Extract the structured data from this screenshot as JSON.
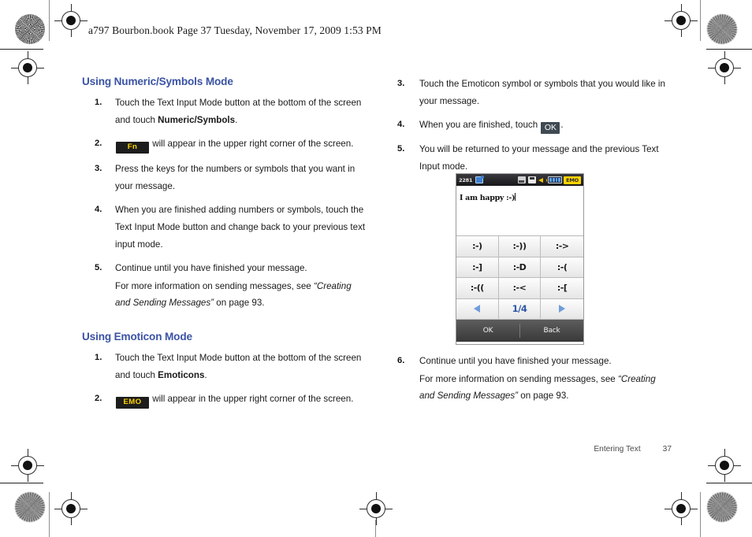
{
  "running_head": "a797 Bourbon.book  Page 37  Tuesday, November 17, 2009  1:53 PM",
  "accent_heading_color": "#3a53a4",
  "left_column": {
    "section1_title": "Using Numeric/Symbols Mode",
    "section1_steps": [
      {
        "num": "1.",
        "pre": "Touch the Text Input Mode button at the bottom of the screen and touch ",
        "bold": "Numeric/Symbols",
        "post": "."
      },
      {
        "num": "2.",
        "badge": "Fn",
        "pre": "",
        "post": " will appear in the upper right corner of the screen."
      },
      {
        "num": "3.",
        "pre": "Press the keys for the numbers or symbols that you want in your message.",
        "post": ""
      },
      {
        "num": "4.",
        "pre": "When you are finished adding numbers or symbols, touch the Text Input Mode button and change back to your previous text input mode.",
        "post": ""
      },
      {
        "num": "5.",
        "pre": "Continue until you have finished your message.",
        "post": ""
      }
    ],
    "section1_note_pre": "For more information on sending messages, see ",
    "section1_note_italic": "“Creating and Sending Messages”",
    "section1_note_post": " on page 93.",
    "section2_title": "Using Emoticon Mode",
    "section2_steps": [
      {
        "num": "1.",
        "pre": "Touch the Text Input Mode button at the bottom of the screen and touch ",
        "bold": "Emoticons",
        "post": "."
      },
      {
        "num": "2.",
        "badge": "EMO",
        "pre": "",
        "post": " will appear in the upper right corner of the screen."
      }
    ]
  },
  "right_column": {
    "steps_top": [
      {
        "num": "3.",
        "pre": "Touch the Emoticon symbol or symbols that you would like in your message.",
        "post": ""
      },
      {
        "num": "4.",
        "pre": "When you are finished, touch ",
        "badge_ok": "OK",
        "post": "."
      },
      {
        "num": "5.",
        "pre": "You will be returned to your message and the previous Text Input mode.",
        "post": ""
      }
    ],
    "step_after": {
      "num": "6.",
      "pre": "Continue until you have finished your message.",
      "post": ""
    },
    "note_pre": "For more information on sending messages, see ",
    "note_italic": "“Creating and Sending Messages”",
    "note_post": " on page 93."
  },
  "phone_screenshot": {
    "status_bar": {
      "time": "2281",
      "icons": [
        "message-icon",
        "contacts-icon",
        "save-icon",
        "volume-icon",
        "battery-icon"
      ],
      "mode_badge": "EMO"
    },
    "message_text": "I am happy :-)",
    "emoticons": [
      ":-)",
      ":-))",
      ":->",
      ":-]",
      ":-D",
      ":-(",
      ":-((",
      ":-<",
      ":-["
    ],
    "page_indicator": "1/4",
    "nav_prev": "prev-arrow-icon",
    "nav_next": "next-arrow-icon",
    "softkeys": {
      "left": "OK",
      "right": "Back"
    }
  },
  "footer": {
    "label": "Entering Text",
    "page_number": "37"
  }
}
